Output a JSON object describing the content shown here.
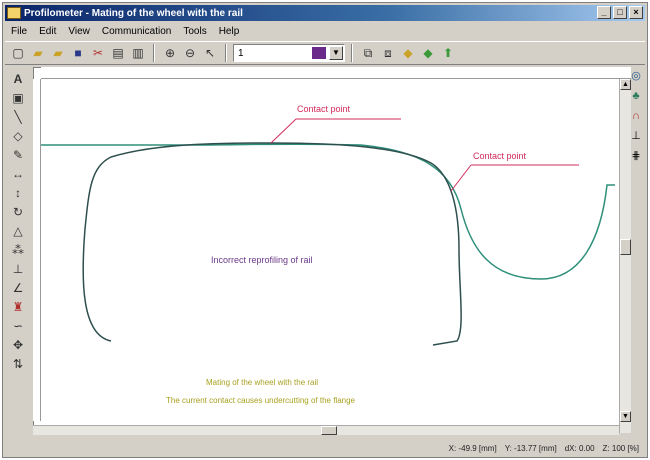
{
  "window": {
    "title": "Profilometer - Mating of the wheel with the rail",
    "buttons": [
      "_",
      "□",
      "×"
    ]
  },
  "menu": [
    "File",
    "Edit",
    "View",
    "Communication",
    "Tools",
    "Help"
  ],
  "toolbar": {
    "line_width_value": "1"
  },
  "drawing": {
    "contact_point_top": "Contact point",
    "contact_point_right": "Contact point",
    "profile_label": "Incorrect reprofiling of rail",
    "note_line1": "Mating of the wheel with the rail",
    "note_line2": "The current contact causes undercutting of the flange"
  },
  "status": {
    "x": "X: -49.9 [mm]",
    "y": "Y: -13.77 [mm]",
    "dx": "dX: 0.00",
    "zoom": "Z: 100 [%]"
  },
  "colors": {
    "title_bar": "#0a246a",
    "curve": "#2e8f7a",
    "wheel_profile": "#2f4f4f",
    "annotation_red": "#d22a5a",
    "profile_label": "#6a3a8a",
    "note_text": "#a8a020"
  }
}
